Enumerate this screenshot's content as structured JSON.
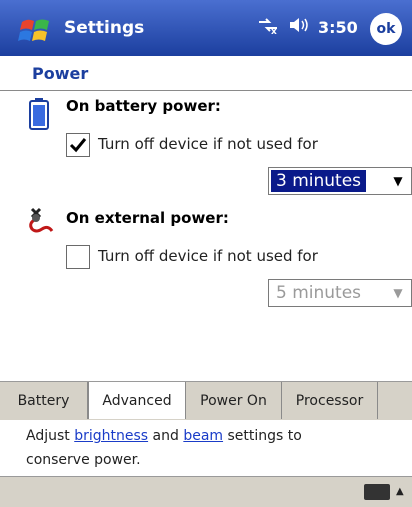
{
  "titlebar": {
    "title": "Settings",
    "time": "3:50",
    "ok_label": "ok"
  },
  "page": {
    "title": "Power"
  },
  "battery": {
    "heading": "On battery power:",
    "checkbox_label": "Turn off device if not used for",
    "checked": true,
    "dropdown_value": "3 minutes"
  },
  "external": {
    "heading": "On external power:",
    "checkbox_label": "Turn off device if not used for",
    "checked": false,
    "dropdown_value": "5 minutes"
  },
  "tabs": [
    {
      "label": "Battery"
    },
    {
      "label": "Advanced"
    },
    {
      "label": "Power On"
    },
    {
      "label": "Processor"
    }
  ],
  "active_tab": "Advanced",
  "hint": {
    "prefix": "Adjust ",
    "link1": "brightness",
    "middle": " and ",
    "link2": "beam",
    "suffix": " settings to",
    "line2": "conserve power."
  },
  "icons": [
    "windows-start-icon",
    "connectivity-icon",
    "speaker-icon",
    "battery-icon",
    "plug-icon",
    "keyboard-icon",
    "up-arrow-icon"
  ],
  "colors": {
    "titlebar": "#1c3f9f",
    "accent": "#1c3f9f",
    "selection": "#0a1a8a",
    "link": "#1a3cc8"
  }
}
